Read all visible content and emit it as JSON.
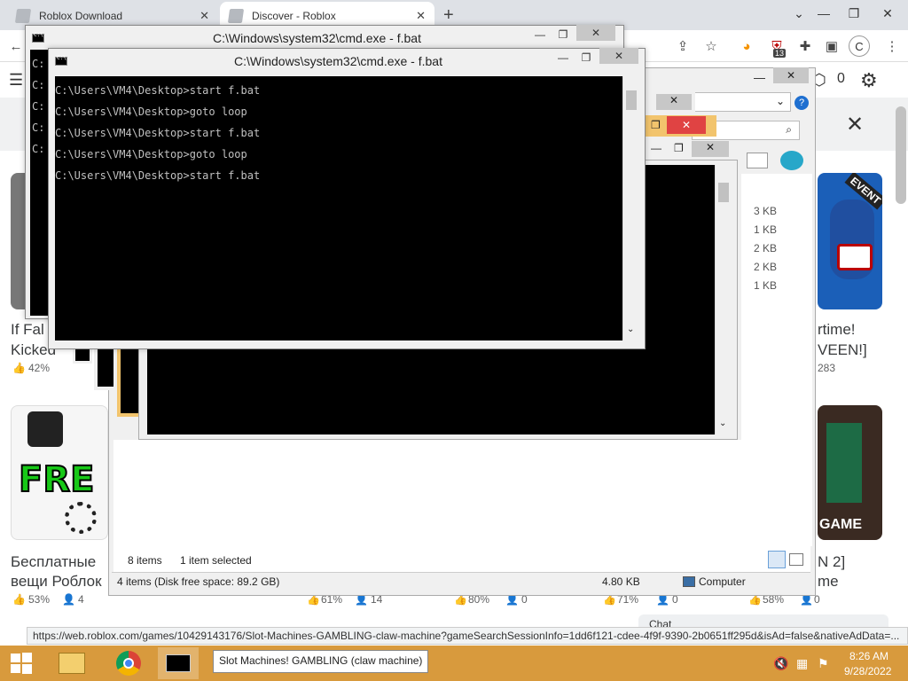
{
  "browser": {
    "tabs": [
      {
        "title": "Roblox Download"
      },
      {
        "title": "Discover - Roblox"
      }
    ],
    "new_tab": "+",
    "profile_initial": "C",
    "extension_badge": "13",
    "status_url": "https://web.roblox.com/games/10429143176/Slot-Machines-GAMBLING-claw-machine?gameSearchSessionInfo=1dd6f121-cdee-4f9f-9390-2b0651ff295d&isAd=false&nativeAdData=..."
  },
  "roblox": {
    "robux_count": "0",
    "cards": [
      {
        "line1": "If Fal",
        "line2": "Kicked",
        "rating": "42%",
        "players": ""
      },
      {
        "line1": "rtime!",
        "line2": "VEEN!]",
        "rating": "",
        "players": "283"
      },
      {
        "line1": "Бесплатные",
        "line2": "вещи Роблок",
        "rating": "53%",
        "players": "4"
      },
      {
        "line1": "N 2]",
        "line2": "me",
        "rating": "58%",
        "players": "0"
      }
    ],
    "mid_stats": [
      {
        "rating": "61%",
        "players": "14"
      },
      {
        "rating": "80%",
        "players": "0"
      },
      {
        "rating": "71%",
        "players": "0"
      }
    ],
    "event_badge": "EVENT",
    "free_text": "FRE",
    "game_text": "GAME",
    "chat_label": "Chat"
  },
  "cmd_back": {
    "title": "C:\\Windows\\system32\\cmd.exe - f.bat"
  },
  "cmd_front": {
    "title": "C:\\Windows\\system32\\cmd.exe - f.bat",
    "lines": [
      "C:\\Users\\VM4\\Desktop>start f.bat",
      "C:\\Users\\VM4\\Desktop>goto loop",
      "C:\\Users\\VM4\\Desktop>start f.bat",
      "C:\\Users\\VM4\\Desktop>goto loop",
      "C:\\Users\\VM4\\Desktop>start f.bat"
    ],
    "back_prompt_chars": [
      "C:",
      "C:",
      "C:",
      "C:",
      "C:"
    ]
  },
  "explorer": {
    "sizes": [
      "3 KB",
      "1 KB",
      "2 KB",
      "2 KB",
      "1 KB"
    ],
    "status_items": "8 items",
    "status_selected": "1 item selected",
    "bottom_items": "4 items (Disk free space: 89.2 GB)",
    "bottom_size": "4.80 KB",
    "bottom_location": "Computer"
  },
  "taskbar": {
    "active_window_title": "Slot Machines! GAMBLING (claw machine)",
    "time": "8:26 AM",
    "date": "9/28/2022"
  },
  "colors": {
    "taskbar": "#d89a3d",
    "console_bg": "#000000",
    "console_fg": "#c0c0c0",
    "accent_blue": "#1a73e8"
  }
}
